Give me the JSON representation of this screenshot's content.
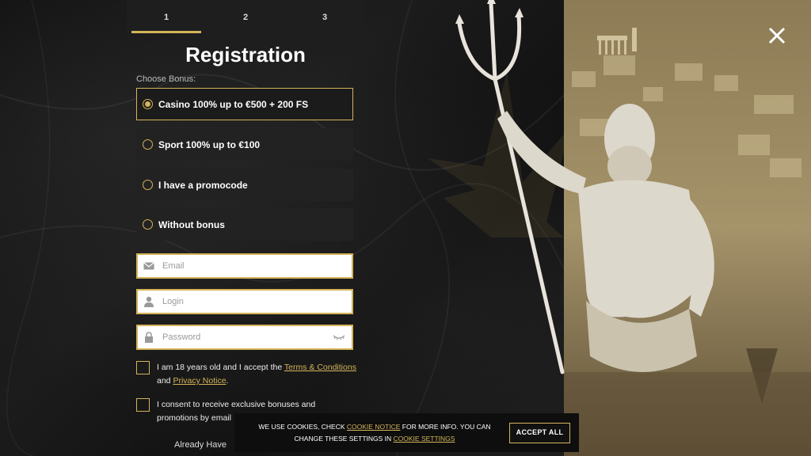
{
  "steps": [
    {
      "label": "1"
    },
    {
      "label": "2"
    },
    {
      "label": "3"
    }
  ],
  "active_step": 1,
  "title": "Registration",
  "choose_bonus_label": "Choose Bonus:",
  "bonuses": [
    {
      "label": "Casino 100% up to €500 + 200 FS",
      "selected": true
    },
    {
      "label": "Sport 100% up to €100",
      "selected": false
    },
    {
      "label": "I have a promocode",
      "selected": false
    },
    {
      "label": "Without bonus",
      "selected": false
    }
  ],
  "fields": {
    "email_placeholder": "Email",
    "login_placeholder": "Login",
    "password_placeholder": "Password"
  },
  "consent": {
    "age_text": "I am 18 years old and I accept the ",
    "terms_link": "Terms & Conditions",
    "and_text": "and ",
    "privacy_link": "Privacy Notice",
    "period": ".",
    "promo_text": "I consent to receive exclusive bonuses and promotions by email"
  },
  "already_text": "Already Have",
  "cookie": {
    "text_1": "WE USE COOKIES, CHECK ",
    "notice_link": "COOKIE NOTICE",
    "text_2": " FOR MORE INFO. YOU CAN CHANGE THESE SETTINGS IN ",
    "settings_link": "COOKIE SETTINGS",
    "accept_label": "ACCEPT ALL"
  },
  "colors": {
    "accent": "#d4b45a",
    "panel_bg": "#222222",
    "page_bg": "#141414"
  },
  "icons": [
    "close-icon",
    "envelope-icon",
    "user-icon",
    "lock-icon",
    "eye-closed-icon"
  ]
}
